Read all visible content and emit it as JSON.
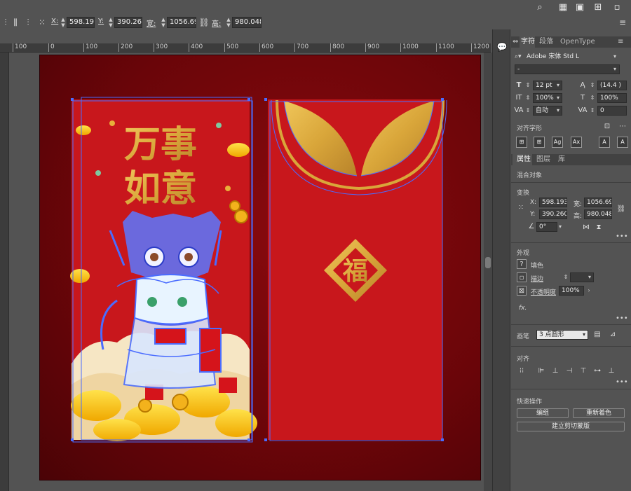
{
  "toolbar": {
    "x_label": "X:",
    "x_value": "598.1934",
    "y_label": "Y:",
    "y_value": "390.2608",
    "w_label": "宽:",
    "w_value": "1056.6941",
    "h_label": "高:",
    "h_value": "980.0488"
  },
  "rulers": {
    "top_ticks": [
      "100",
      "0",
      "100",
      "200",
      "300",
      "400",
      "500",
      "600",
      "700",
      "800",
      "900",
      "1000",
      "1100",
      "1200"
    ]
  },
  "artboard": {
    "left_card": {
      "title_line1": "万事",
      "title_line2": "如意"
    },
    "right_card": {
      "emblem_char": "福"
    }
  },
  "panel": {
    "char_tabs": [
      "字符",
      "段落",
      "OpenType"
    ],
    "font_family": "Adobe 宋体 Std L",
    "font_style": "-",
    "font_size": "12 pt",
    "leading": "(14.4 )",
    "vscale": "100%",
    "hscale": "100%",
    "kerning": "自动",
    "tracking": "0",
    "glyph_section": "对齐字形",
    "prop_tabs": [
      "属性",
      "图层",
      "库"
    ],
    "object_type": "混合对象",
    "transform_title": "变换",
    "px_label": "X:",
    "px_value": "598.1934",
    "pw_label": "宽:",
    "pw_value": "1056.694",
    "py_label": "Y:",
    "py_value": "390.2608",
    "ph_label": "高:",
    "ph_value": "980.0488",
    "angle_value": "0°",
    "appearance_title": "外观",
    "fill_label": "填色",
    "stroke_label": "描边",
    "opacity_label": "不透明度",
    "opacity_value": "100%",
    "fx_label": "fx.",
    "brush_label": "画笔",
    "brush_value": "3 点圆形",
    "align_title": "对齐",
    "quick_title": "快速操作",
    "group_button": "编组",
    "recolor_button": "重新着色",
    "clip_button": "建立剪切蒙版"
  },
  "colors": {
    "red": "#c8171c",
    "gold": "#d9a63a",
    "selection": "#4a6cff"
  }
}
